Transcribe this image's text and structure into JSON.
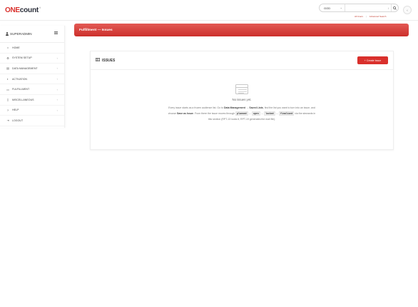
{
  "logo": {
    "one": "ONE",
    "count": "count",
    "tm": "®"
  },
  "search": {
    "select_value": "GOD",
    "placeholder": "",
    "slash": "/"
  },
  "top_links": {
    "left": "All Users",
    "sep": "|",
    "right": "Advanced Search"
  },
  "sidebar": {
    "user": "SUPERADMIN",
    "items": [
      {
        "label": "HOME",
        "icon": "home-icon",
        "glyph": "⌂"
      },
      {
        "label": "SYSTEM SETUP",
        "icon": "gear-icon",
        "glyph": "⚙"
      },
      {
        "label": "DATA MANAGEMENT",
        "icon": "database-icon",
        "glyph": "▤"
      },
      {
        "label": "ACTIVATION",
        "icon": "toggle-icon",
        "glyph": "◐"
      },
      {
        "label": "FULFILLMENT",
        "icon": "truck-icon",
        "glyph": "▭"
      },
      {
        "label": "MISCELLANEOUS",
        "icon": "file-icon",
        "glyph": "▯"
      },
      {
        "label": "HELP",
        "icon": "question-icon",
        "glyph": "?"
      },
      {
        "label": "LOGOUT",
        "icon": "logout-icon",
        "glyph": "⇥"
      }
    ]
  },
  "banner": {
    "title": "Fulfillment — Issues"
  },
  "card": {
    "title": "ISSUES",
    "create_label": "Create Issue",
    "empty_title": "No issues yet.",
    "desc": {
      "t1": "Every issue starts as a frozen audience list. Go to ",
      "b1": "Data Management",
      "t2": " → ",
      "b2": "Saved Lists",
      "t3": ", find the list you want to turn into an issue, and choose ",
      "b3": "Save as Issue",
      "t4": ". From there the issue moves through ",
      "c1": "planned",
      "a1": " → ",
      "c2": "open",
      "a2": " → ",
      "c3": "locked",
      "a3": " → ",
      "c4": "finalized",
      "t5": " via the stewards in this section (RPT-13 looks it; RPT-19 generates the mail file)."
    }
  },
  "colors": {
    "accent": "#d9302c",
    "banner_top": "#e35a55",
    "banner_bottom": "#cc2f2b"
  }
}
